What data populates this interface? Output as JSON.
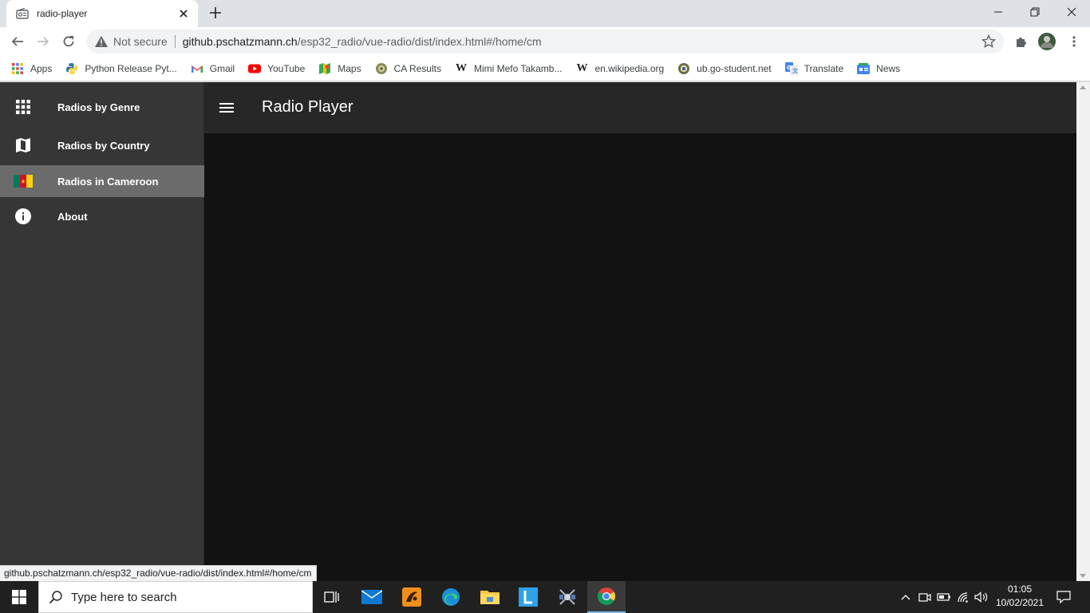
{
  "browser": {
    "tab_title": "radio-player",
    "tab_close_icon": "close-icon",
    "new_tab_icon": "plus-icon",
    "window_controls": [
      "minimize-icon",
      "restore-icon",
      "close-icon"
    ],
    "security_label": "Not secure",
    "url_host": "github.pschatzmann.ch",
    "url_path": "/esp32_radio/vue-radio/dist/index.html#/home/cm",
    "bookmarks": [
      {
        "label": "Apps",
        "icon": "apps-grid-icon"
      },
      {
        "label": "Python Release Pyt...",
        "icon": "python-icon"
      },
      {
        "label": "Gmail",
        "icon": "gmail-icon"
      },
      {
        "label": "YouTube",
        "icon": "youtube-icon"
      },
      {
        "label": "Maps",
        "icon": "maps-icon"
      },
      {
        "label": "CA Results",
        "icon": "ca-results-icon"
      },
      {
        "label": "Mimi Mefo Takamb...",
        "icon": "wikipedia-icon"
      },
      {
        "label": "en.wikipedia.org",
        "icon": "wikipedia-icon"
      },
      {
        "label": "ub.go-student.net",
        "icon": "ub-icon"
      },
      {
        "label": "Translate",
        "icon": "translate-icon"
      },
      {
        "label": "News",
        "icon": "news-icon"
      }
    ],
    "status_url": "github.pschatzmann.ch/esp32_radio/vue-radio/dist/index.html#/home/cm"
  },
  "app": {
    "title": "Radio Player",
    "menu_icon": "hamburger-menu-icon",
    "drawer": {
      "items": [
        {
          "label": "Radios by Genre",
          "icon": "grid-icon",
          "active": false
        },
        {
          "label": "Radios by Country",
          "icon": "map-icon",
          "active": false
        },
        {
          "label": "Radios in Cameroon",
          "icon": "cameroon-flag-icon",
          "active": true
        },
        {
          "label": "About",
          "icon": "info-icon",
          "active": false
        }
      ]
    }
  },
  "taskbar": {
    "search_placeholder": "Type here to search",
    "clock_time": "01:05",
    "clock_date": "10/02/2021"
  },
  "colors": {
    "drawer_bg": "#363636",
    "drawer_active": "#6b6b6b",
    "appbar_bg": "#272727",
    "content_bg": "#121212",
    "taskbar_bg": "#202020"
  }
}
